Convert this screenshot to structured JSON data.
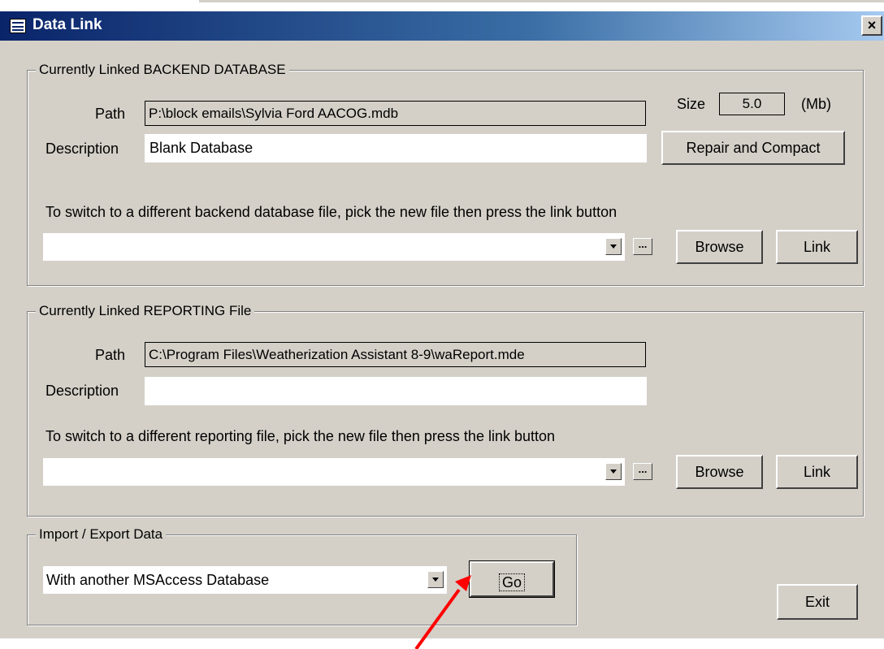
{
  "window": {
    "title": "Data Link",
    "close_label": "×"
  },
  "backend": {
    "group_label": "Currently Linked BACKEND DATABASE",
    "path_label": "Path",
    "path_value": "P:\\block emails\\Sylvia Ford AACOG.mdb",
    "description_label": "Description",
    "description_value": "Blank Database",
    "size_label": "Size",
    "size_value": "5.0",
    "size_unit": "(Mb)",
    "repair_button": "Repair and Compact",
    "switch_instruction": "To switch to a different backend database file, pick the new file then press the link button",
    "file_combo_value": "",
    "ellipsis_button": "...",
    "browse_button": "Browse",
    "link_button": "Link"
  },
  "reporting": {
    "group_label": "Currently Linked REPORTING File",
    "path_label": "Path",
    "path_value": "C:\\Program Files\\Weatherization Assistant 8-9\\waReport.mde",
    "description_label": "Description",
    "description_value": "",
    "switch_instruction": "To switch to a different reporting file, pick the new file then press the link button",
    "file_combo_value": "",
    "ellipsis_button": "...",
    "browse_button": "Browse",
    "link_button": "Link"
  },
  "import_export": {
    "group_label": "Import / Export Data",
    "combo_value": "With another MSAccess Database",
    "go_button": "Go"
  },
  "exit_button": "Exit",
  "colors": {
    "dialog_bg": "#d4d0c8",
    "title_bar_start": "#0a246a",
    "title_bar_end": "#a6caf0",
    "annotation_arrow": "#ff0000"
  }
}
